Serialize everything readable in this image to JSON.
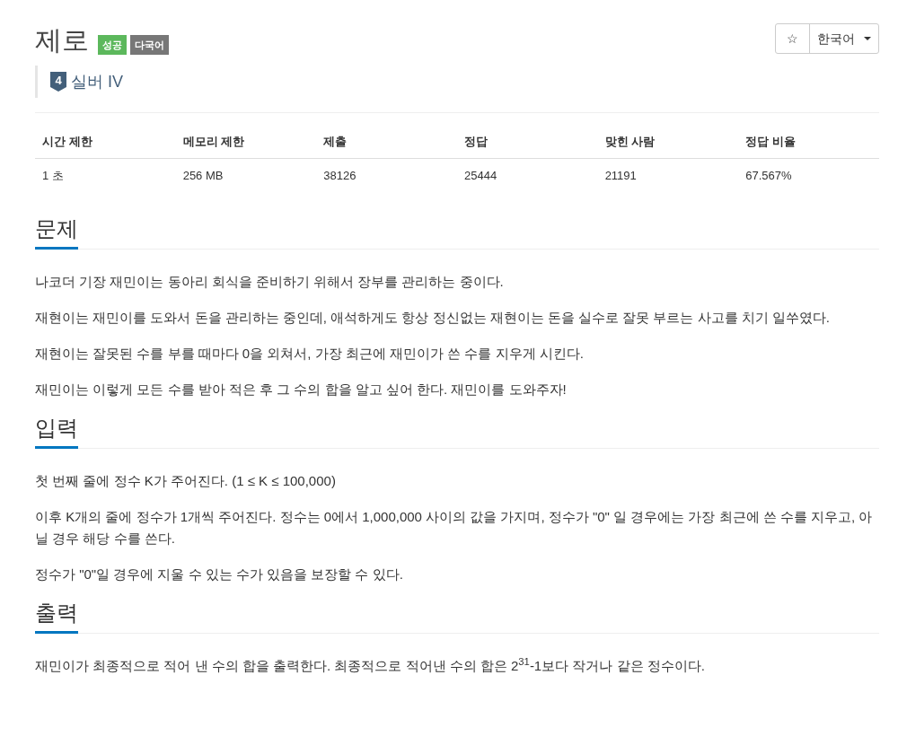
{
  "title": "제로",
  "labels": [
    {
      "text": "성공",
      "kind": "success"
    },
    {
      "text": "다국어",
      "kind": "language"
    }
  ],
  "star_button": "☆",
  "language_select": {
    "value": "한국어"
  },
  "tier": {
    "number": "4",
    "name": "실버 IV"
  },
  "stats": {
    "columns": [
      "시간 제한",
      "메모리 제한",
      "제출",
      "정답",
      "맞힌 사람",
      "정답 비율"
    ],
    "row": [
      "1 초",
      "256 MB",
      "38126",
      "25444",
      "21191",
      "67.567%"
    ]
  },
  "sections": [
    {
      "heading": "문제",
      "paragraphs": [
        "나코더 기장 재민이는 동아리 회식을 준비하기 위해서 장부를 관리하는 중이다.",
        "재현이는 재민이를 도와서 돈을 관리하는 중인데, 애석하게도 항상 정신없는 재현이는 돈을 실수로 잘못 부르는 사고를 치기 일쑤였다.",
        "재현이는 잘못된 수를 부를 때마다 0을 외쳐서, 가장 최근에 재민이가 쓴 수를 지우게 시킨다.",
        "재민이는 이렇게 모든 수를 받아 적은 후 그 수의 합을 알고 싶어 한다. 재민이를 도와주자!"
      ]
    },
    {
      "heading": "입력",
      "paragraphs": [
        "첫 번째 줄에 정수 K가 주어진다. (1 ≤ K ≤ 100,000)",
        "이후 K개의 줄에 정수가 1개씩 주어진다. 정수는 0에서 1,000,000 사이의 값을 가지며, 정수가 \"0\" 일 경우에는 가장 최근에 쓴 수를 지우고, 아닐 경우 해당 수를 쓴다.",
        "정수가 \"0\"일 경우에 지울 수 있는 수가 있음을 보장할 수 있다."
      ]
    },
    {
      "heading": "출력",
      "paragraphs": [
        "재민이가 최종적으로 적어 낸 수의 합을 출력한다. 최종적으로 적어낸 수의 합은 2$^{31}$-1보다 작거나 같은 정수이다."
      ]
    }
  ]
}
